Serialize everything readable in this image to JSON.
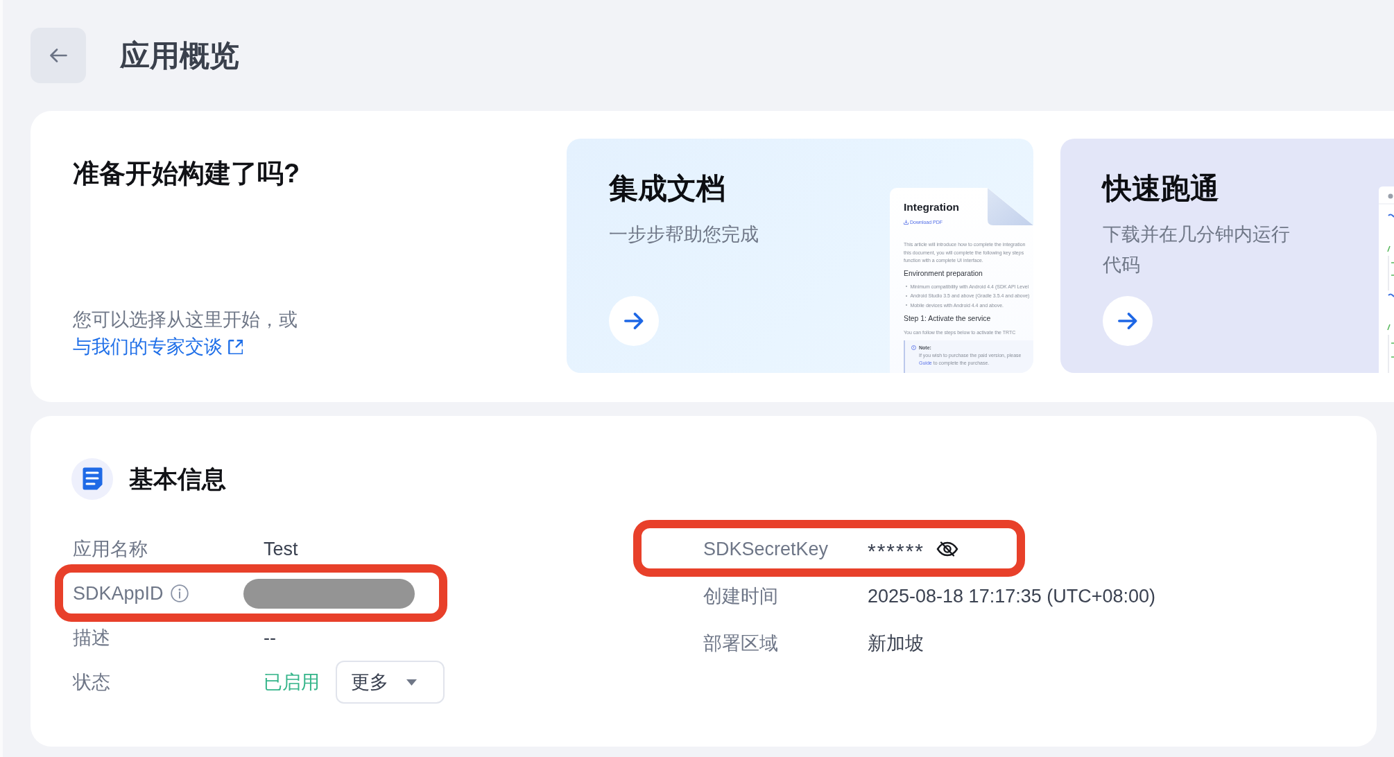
{
  "header": {
    "title": "应用概览"
  },
  "intro": {
    "title": "准备开始构建了吗?",
    "text": "您可以选择从这里开始，或",
    "link": "与我们的专家交谈"
  },
  "guide_cards": [
    {
      "kind": "document",
      "title": "集成文档",
      "subtitle": "一步步帮助您完成",
      "preview": {
        "title": "Integration",
        "download": "Download PDF",
        "blocks": [
          {
            "kind": "paragraph",
            "lines": [
              "This article will introduce how to complete the integration",
              "this document, you will complete the following key steps",
              "function with a complete UI interface."
            ]
          },
          {
            "kind": "heading",
            "text": "Environment preparation"
          },
          {
            "kind": "bullets",
            "items": [
              "Minimum compatibility with Android 4.4 (SDK API Level",
              "Android Studio 3.5 and above (Gradle 3.5.4 and above)",
              "Mobile devices with Android 4.4 and above."
            ]
          },
          {
            "kind": "heading",
            "text": "Step 1: Activate the service"
          },
          {
            "kind": "paragraph",
            "lines": [
              "You can follow the steps below to activate the TRTC"
            ]
          },
          {
            "kind": "note",
            "title": "Note:",
            "lines": [
              "If you wish to purchase the paid version, please"
            ],
            "link": "Guide",
            "after": "to complete the purchase."
          }
        ]
      }
    },
    {
      "kind": "code",
      "title": "快速跑通",
      "subtitle": "下载并在几分钟内运行代码"
    }
  ],
  "basic_info": {
    "title": "基本信息",
    "left": [
      {
        "kind": "text",
        "label": "应用名称",
        "value": "Test",
        "info_icon": false,
        "highlighted": false
      },
      {
        "kind": "redacted",
        "label": "SDKAppID",
        "info_icon": true,
        "highlighted": true
      },
      {
        "kind": "text",
        "label": "描述",
        "value": "--",
        "info_icon": false,
        "highlighted": false
      },
      {
        "kind": "status",
        "label": "状态",
        "value": "已启用",
        "menu": "更多",
        "info_icon": false,
        "highlighted": false
      }
    ],
    "right": [
      {
        "kind": "secret",
        "label": "SDKSecretKey",
        "value": "******",
        "info_icon": false,
        "highlighted": true
      },
      {
        "kind": "text",
        "label": "创建时间",
        "value": "2025-08-18 17:17:35 (UTC+08:00)",
        "info_icon": false,
        "highlighted": false
      },
      {
        "kind": "text",
        "label": "部署区域",
        "value": "新加坡",
        "info_icon": false,
        "highlighted": false
      }
    ]
  }
}
